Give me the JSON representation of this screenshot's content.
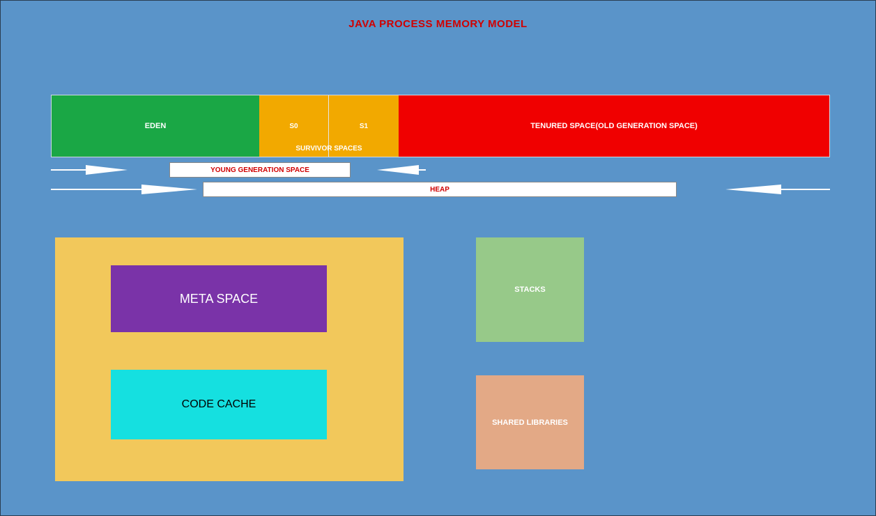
{
  "title": "JAVA PROCESS MEMORY MODEL",
  "heap": {
    "eden": "EDEN",
    "s0": "S0",
    "s1": "S1",
    "survivors_label": "SURVIVOR SPACES",
    "tenured": "TENURED SPACE(OLD GENERATION SPACE)"
  },
  "ribbons": {
    "young": "YOUNG GENERATION SPACE",
    "heap": "HEAP"
  },
  "nonheap": {
    "meta": "META SPACE",
    "code": "CODE CACHE"
  },
  "native": {
    "stacks": "STACKS",
    "shared": "SHARED LIBRARIES"
  },
  "colors": {
    "bg": "#5a94c9",
    "eden": "#1aa745",
    "survivor": "#f2a900",
    "tenured": "#f00000",
    "nonheap": "#f2c85b",
    "meta": "#7a33a8",
    "code": "#15e0e0",
    "stacks": "#97c989",
    "shared": "#e3a986",
    "title_text": "#d00000"
  }
}
